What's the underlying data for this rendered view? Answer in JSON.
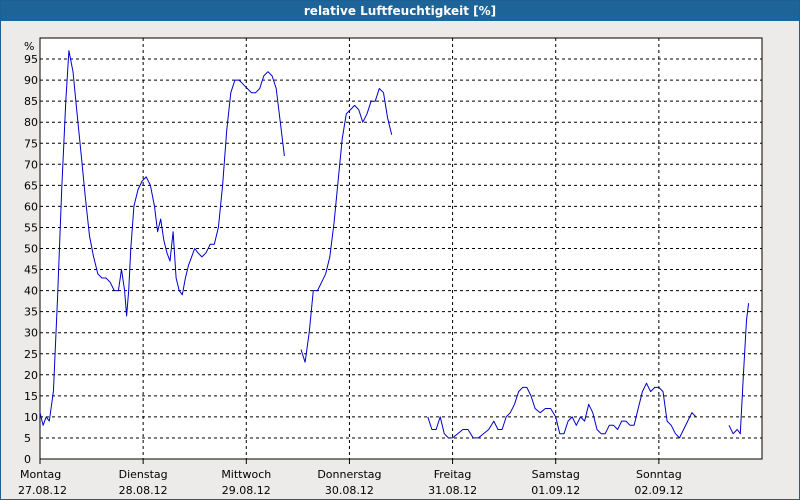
{
  "window": {
    "title": "relative Luftfeuchtigkeit [%]"
  },
  "chart_data": {
    "type": "line",
    "title": "relative Luftfeuchtigkeit [%]",
    "ylabel": "%",
    "xlabel": "",
    "ylim": [
      0,
      100
    ],
    "yticks": [
      0,
      5,
      10,
      15,
      20,
      25,
      30,
      35,
      40,
      45,
      50,
      55,
      60,
      65,
      70,
      75,
      80,
      85,
      90,
      95
    ],
    "xlim": [
      0,
      7
    ],
    "x_unit": "days since Montag 27.08.12 00:00",
    "x_ticks": [
      {
        "x": 0,
        "day": "Montag",
        "date": "27.08.12"
      },
      {
        "x": 1,
        "day": "Dienstag",
        "date": "28.08.12"
      },
      {
        "x": 2,
        "day": "Mittwoch",
        "date": "29.08.12"
      },
      {
        "x": 3,
        "day": "Donnerstag",
        "date": "30.08.12"
      },
      {
        "x": 4,
        "day": "Freitag",
        "date": "31.08.12"
      },
      {
        "x": 5,
        "day": "Samstag",
        "date": "01.09.12"
      },
      {
        "x": 6,
        "day": "Sonntag",
        "date": "02.09.12"
      }
    ],
    "grid": true,
    "line_color": "#0000cc",
    "series": [
      {
        "segments": [
          [
            [
              0.0,
              11
            ],
            [
              0.03,
              8
            ],
            [
              0.06,
              10
            ],
            [
              0.09,
              9
            ],
            [
              0.13,
              16
            ],
            [
              0.17,
              38
            ],
            [
              0.21,
              64
            ],
            [
              0.25,
              85
            ],
            [
              0.28,
              97
            ],
            [
              0.32,
              92
            ],
            [
              0.36,
              82
            ],
            [
              0.4,
              72
            ],
            [
              0.44,
              62
            ],
            [
              0.48,
              53
            ],
            [
              0.52,
              48
            ],
            [
              0.56,
              44
            ],
            [
              0.6,
              43
            ],
            [
              0.64,
              43
            ],
            [
              0.68,
              42
            ],
            [
              0.72,
              40
            ],
            [
              0.76,
              40
            ],
            [
              0.79,
              45
            ],
            [
              0.82,
              40
            ],
            [
              0.84,
              34
            ],
            [
              0.86,
              40
            ],
            [
              0.88,
              50
            ],
            [
              0.91,
              60
            ],
            [
              0.95,
              64
            ],
            [
              0.99,
              66
            ],
            [
              1.03,
              67
            ],
            [
              1.07,
              65
            ],
            [
              1.11,
              60
            ],
            [
              1.14,
              54
            ],
            [
              1.17,
              57
            ],
            [
              1.2,
              52
            ],
            [
              1.23,
              49
            ],
            [
              1.26,
              47
            ],
            [
              1.29,
              54
            ],
            [
              1.32,
              43
            ],
            [
              1.35,
              40
            ],
            [
              1.38,
              39
            ],
            [
              1.41,
              43
            ],
            [
              1.44,
              46
            ],
            [
              1.47,
              48
            ],
            [
              1.5,
              50
            ],
            [
              1.53,
              49
            ],
            [
              1.57,
              48
            ],
            [
              1.61,
              49
            ],
            [
              1.65,
              51
            ],
            [
              1.69,
              51
            ],
            [
              1.73,
              55
            ],
            [
              1.77,
              65
            ],
            [
              1.81,
              78
            ],
            [
              1.85,
              87
            ],
            [
              1.89,
              90
            ],
            [
              1.93,
              90
            ],
            [
              1.97,
              89
            ],
            [
              2.01,
              88
            ],
            [
              2.05,
              87
            ],
            [
              2.09,
              87
            ],
            [
              2.13,
              88
            ],
            [
              2.17,
              91
            ],
            [
              2.21,
              92
            ],
            [
              2.25,
              91
            ],
            [
              2.29,
              88
            ],
            [
              2.33,
              80
            ],
            [
              2.37,
              72
            ]
          ],
          [
            [
              2.53,
              26
            ],
            [
              2.57,
              23
            ],
            [
              2.61,
              30
            ],
            [
              2.65,
              40
            ],
            [
              2.69,
              40
            ],
            [
              2.73,
              42
            ],
            [
              2.77,
              44
            ],
            [
              2.81,
              48
            ],
            [
              2.85,
              56
            ],
            [
              2.89,
              66
            ],
            [
              2.93,
              76
            ],
            [
              2.97,
              82
            ],
            [
              3.01,
              83
            ],
            [
              3.05,
              84
            ],
            [
              3.09,
              83
            ],
            [
              3.13,
              80
            ],
            [
              3.17,
              82
            ],
            [
              3.21,
              85
            ],
            [
              3.25,
              85
            ],
            [
              3.29,
              88
            ],
            [
              3.33,
              87
            ],
            [
              3.37,
              81
            ],
            [
              3.41,
              77
            ]
          ],
          [
            [
              3.76,
              10
            ],
            [
              3.8,
              7
            ],
            [
              3.84,
              7
            ],
            [
              3.88,
              10
            ],
            [
              3.92,
              6
            ],
            [
              3.96,
              5
            ],
            [
              4.0,
              5
            ],
            [
              4.05,
              6
            ],
            [
              4.1,
              7
            ],
            [
              4.15,
              7
            ],
            [
              4.2,
              5
            ],
            [
              4.25,
              5
            ],
            [
              4.3,
              6
            ],
            [
              4.35,
              7
            ],
            [
              4.4,
              9
            ],
            [
              4.44,
              7
            ],
            [
              4.48,
              7
            ],
            [
              4.52,
              10
            ],
            [
              4.56,
              11
            ],
            [
              4.6,
              13
            ],
            [
              4.64,
              16
            ],
            [
              4.68,
              17
            ],
            [
              4.72,
              17
            ],
            [
              4.76,
              15
            ],
            [
              4.8,
              12
            ],
            [
              4.85,
              11
            ],
            [
              4.9,
              12
            ],
            [
              4.95,
              12
            ],
            [
              5.0,
              10
            ],
            [
              5.04,
              6
            ],
            [
              5.08,
              6
            ],
            [
              5.12,
              9
            ],
            [
              5.16,
              10
            ],
            [
              5.2,
              8
            ],
            [
              5.24,
              10
            ],
            [
              5.28,
              9
            ],
            [
              5.32,
              13
            ],
            [
              5.36,
              11
            ],
            [
              5.4,
              7
            ],
            [
              5.44,
              6
            ],
            [
              5.48,
              6
            ],
            [
              5.52,
              8
            ],
            [
              5.56,
              8
            ],
            [
              5.6,
              7
            ],
            [
              5.64,
              9
            ],
            [
              5.68,
              9
            ],
            [
              5.72,
              8
            ],
            [
              5.76,
              8
            ],
            [
              5.8,
              12
            ],
            [
              5.84,
              16
            ],
            [
              5.88,
              18
            ],
            [
              5.92,
              16
            ],
            [
              5.96,
              17
            ],
            [
              6.0,
              17
            ],
            [
              6.04,
              16
            ],
            [
              6.08,
              9
            ],
            [
              6.12,
              8
            ],
            [
              6.16,
              6
            ],
            [
              6.2,
              5
            ],
            [
              6.24,
              7
            ],
            [
              6.28,
              9
            ],
            [
              6.32,
              11
            ],
            [
              6.36,
              10
            ]
          ],
          [
            [
              6.68,
              8
            ],
            [
              6.72,
              6
            ],
            [
              6.76,
              7
            ],
            [
              6.79,
              6
            ],
            [
              6.82,
              20
            ],
            [
              6.85,
              33
            ],
            [
              6.87,
              37
            ]
          ]
        ]
      }
    ]
  }
}
